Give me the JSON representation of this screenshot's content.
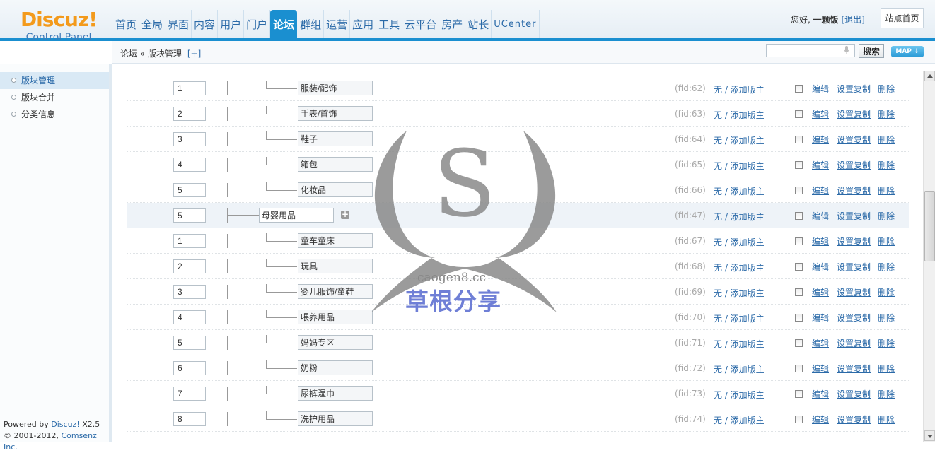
{
  "logo": {
    "name": "Discuz!",
    "subtitle": "Control Panel"
  },
  "nav": [
    {
      "label": "首页"
    },
    {
      "label": "全局"
    },
    {
      "label": "界面"
    },
    {
      "label": "内容"
    },
    {
      "label": "用户"
    },
    {
      "label": "门户"
    },
    {
      "label": "论坛",
      "active": true
    },
    {
      "label": "群组"
    },
    {
      "label": "运营"
    },
    {
      "label": "应用"
    },
    {
      "label": "工具"
    },
    {
      "label": "云平台"
    },
    {
      "label": "房产"
    },
    {
      "label": "站长"
    },
    {
      "label": "UCenter"
    }
  ],
  "user": {
    "greeting": "您好,",
    "name": "一颗饭",
    "logout": "[退出]",
    "site_home": "站点首页"
  },
  "breadcrumb": {
    "section": "论坛",
    "sep": "»",
    "page": "版块管理",
    "add": "[+]"
  },
  "search": {
    "value": "",
    "button": "搜索",
    "map": "MAP"
  },
  "sidebar": {
    "items": [
      {
        "label": "版块管理",
        "active": true
      },
      {
        "label": "版块合并"
      },
      {
        "label": "分类信息"
      }
    ],
    "powered_prefix": "Powered by ",
    "powered_product": "Discuz!",
    "powered_version": " X2.5",
    "copyright_prefix": "© 2001-2012, ",
    "copyright_company": "Comsenz Inc."
  },
  "labels": {
    "moderator": "无 / 添加版主",
    "edit": "编辑",
    "copy": "设置复制",
    "delete": "删除"
  },
  "rows": [
    {
      "type": "child",
      "order": "1",
      "name": "服装/配饰",
      "fid": "(fid:62)"
    },
    {
      "type": "child",
      "order": "2",
      "name": "手表/首饰",
      "fid": "(fid:63)"
    },
    {
      "type": "child",
      "order": "3",
      "name": "鞋子",
      "fid": "(fid:64)"
    },
    {
      "type": "child",
      "order": "4",
      "name": "箱包",
      "fid": "(fid:65)"
    },
    {
      "type": "child",
      "order": "5",
      "name": "化妆品",
      "fid": "(fid:66)"
    },
    {
      "type": "parent",
      "order": "5",
      "name": "母婴用品",
      "fid": "(fid:47)"
    },
    {
      "type": "child",
      "order": "1",
      "name": "童车童床",
      "fid": "(fid:67)"
    },
    {
      "type": "child",
      "order": "2",
      "name": "玩具",
      "fid": "(fid:68)"
    },
    {
      "type": "child",
      "order": "3",
      "name": "婴儿服饰/童鞋",
      "fid": "(fid:69)"
    },
    {
      "type": "child",
      "order": "4",
      "name": "喂养用品",
      "fid": "(fid:70)"
    },
    {
      "type": "child",
      "order": "5",
      "name": "妈妈专区",
      "fid": "(fid:71)"
    },
    {
      "type": "child",
      "order": "6",
      "name": "奶粉",
      "fid": "(fid:72)"
    },
    {
      "type": "child",
      "order": "7",
      "name": "尿裤湿巾",
      "fid": "(fid:73)"
    },
    {
      "type": "child",
      "order": "8",
      "name": "洗护用品",
      "fid": "(fid:74)"
    }
  ],
  "watermark": {
    "site": "caogen8.cc",
    "title": "草根分享",
    "color": "#6f7fd6"
  },
  "colors": {
    "accent": "#1a8fd0",
    "link": "#2b6aa8",
    "brand": "#f39a1c"
  }
}
